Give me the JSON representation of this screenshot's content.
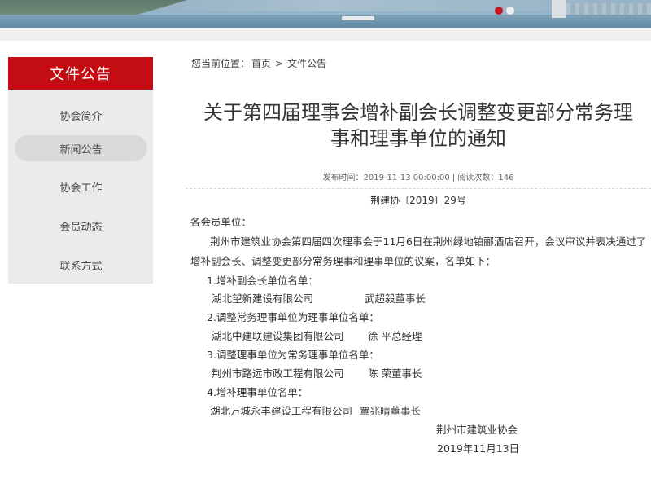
{
  "banner": {
    "dots": [
      true,
      false
    ]
  },
  "sidebar": {
    "header": "文件公告",
    "items": [
      {
        "label": "协会简介"
      },
      {
        "label": "新闻公告"
      },
      {
        "label": "协会工作"
      },
      {
        "label": "会员动态"
      },
      {
        "label": "联系方式"
      }
    ],
    "active_index": 1
  },
  "breadcrumb": {
    "prefix": "您当前位置：",
    "home": "首页",
    "separator": ">",
    "current": "文件公告"
  },
  "article": {
    "title_line1": "关于第四届理事会增补副会长调整变更部分常务理",
    "title_line2": "事和理事单位的通知",
    "meta": "发布时间：2019-11-13 00:00:00 | 阅读次数：146",
    "doc_no": "荆建协〔2019〕29号",
    "salutation": "各会员单位：",
    "intro_line1": "荆州市建筑业协会第四届四次理事会于11月6日在荆州绿地铂郦酒店召开，会议审议并表决通过了",
    "intro_line2": "增补副会长、调整变更部分常务理事和理事单位的议案，名单如下：",
    "sections": [
      {
        "heading": "1.增补副会长单位名单：",
        "company": "湖北望新建设有限公司",
        "person": "武超毅董事长"
      },
      {
        "heading": "2.调整常务理事单位为理事单位名单：",
        "company": "湖北中建联建设集团有限公司",
        "person": "徐   平总经理"
      },
      {
        "heading": "3.调整理事单位为常务理事单位名单：",
        "company": "荆州市路远市政工程有限公司",
        "person": "陈   荣董事长"
      },
      {
        "heading": "4.增补理事单位名单：",
        "company": "湖北万城永丰建设工程有限公司",
        "person": "覃兆晴董事长"
      }
    ],
    "signature_org": "荆州市建筑业协会",
    "signature_date": "2019年11月13日"
  },
  "colors": {
    "accent_red": "#c30d13",
    "sidebar_bg": "#ebebeb",
    "active_pill": "#d9d9d9"
  }
}
